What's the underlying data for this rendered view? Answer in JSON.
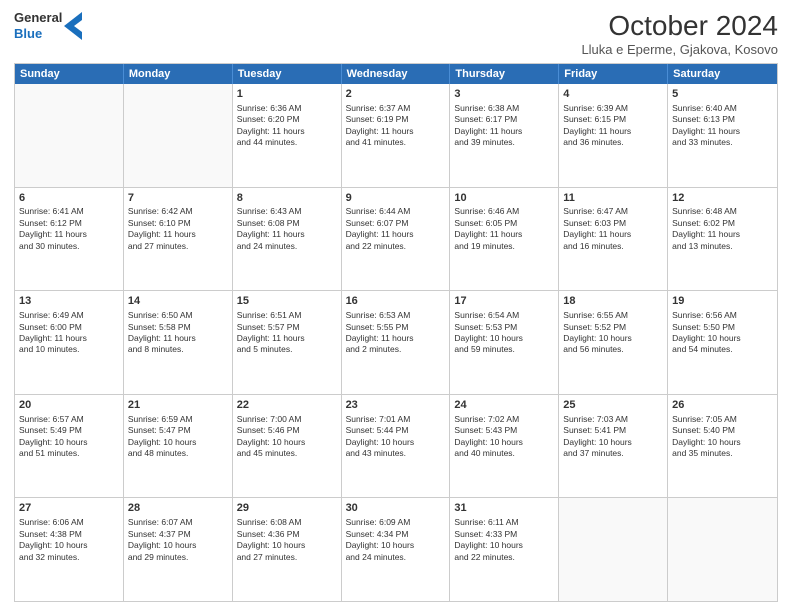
{
  "logo": {
    "line1": "General",
    "line2": "Blue"
  },
  "title": "October 2024",
  "location": "Lluka e Eperme, Gjakova, Kosovo",
  "header": {
    "days": [
      "Sunday",
      "Monday",
      "Tuesday",
      "Wednesday",
      "Thursday",
      "Friday",
      "Saturday"
    ]
  },
  "weeks": [
    [
      {
        "day": "",
        "lines": []
      },
      {
        "day": "",
        "lines": []
      },
      {
        "day": "1",
        "lines": [
          "Sunrise: 6:36 AM",
          "Sunset: 6:20 PM",
          "Daylight: 11 hours",
          "and 44 minutes."
        ]
      },
      {
        "day": "2",
        "lines": [
          "Sunrise: 6:37 AM",
          "Sunset: 6:19 PM",
          "Daylight: 11 hours",
          "and 41 minutes."
        ]
      },
      {
        "day": "3",
        "lines": [
          "Sunrise: 6:38 AM",
          "Sunset: 6:17 PM",
          "Daylight: 11 hours",
          "and 39 minutes."
        ]
      },
      {
        "day": "4",
        "lines": [
          "Sunrise: 6:39 AM",
          "Sunset: 6:15 PM",
          "Daylight: 11 hours",
          "and 36 minutes."
        ]
      },
      {
        "day": "5",
        "lines": [
          "Sunrise: 6:40 AM",
          "Sunset: 6:13 PM",
          "Daylight: 11 hours",
          "and 33 minutes."
        ]
      }
    ],
    [
      {
        "day": "6",
        "lines": [
          "Sunrise: 6:41 AM",
          "Sunset: 6:12 PM",
          "Daylight: 11 hours",
          "and 30 minutes."
        ]
      },
      {
        "day": "7",
        "lines": [
          "Sunrise: 6:42 AM",
          "Sunset: 6:10 PM",
          "Daylight: 11 hours",
          "and 27 minutes."
        ]
      },
      {
        "day": "8",
        "lines": [
          "Sunrise: 6:43 AM",
          "Sunset: 6:08 PM",
          "Daylight: 11 hours",
          "and 24 minutes."
        ]
      },
      {
        "day": "9",
        "lines": [
          "Sunrise: 6:44 AM",
          "Sunset: 6:07 PM",
          "Daylight: 11 hours",
          "and 22 minutes."
        ]
      },
      {
        "day": "10",
        "lines": [
          "Sunrise: 6:46 AM",
          "Sunset: 6:05 PM",
          "Daylight: 11 hours",
          "and 19 minutes."
        ]
      },
      {
        "day": "11",
        "lines": [
          "Sunrise: 6:47 AM",
          "Sunset: 6:03 PM",
          "Daylight: 11 hours",
          "and 16 minutes."
        ]
      },
      {
        "day": "12",
        "lines": [
          "Sunrise: 6:48 AM",
          "Sunset: 6:02 PM",
          "Daylight: 11 hours",
          "and 13 minutes."
        ]
      }
    ],
    [
      {
        "day": "13",
        "lines": [
          "Sunrise: 6:49 AM",
          "Sunset: 6:00 PM",
          "Daylight: 11 hours",
          "and 10 minutes."
        ]
      },
      {
        "day": "14",
        "lines": [
          "Sunrise: 6:50 AM",
          "Sunset: 5:58 PM",
          "Daylight: 11 hours",
          "and 8 minutes."
        ]
      },
      {
        "day": "15",
        "lines": [
          "Sunrise: 6:51 AM",
          "Sunset: 5:57 PM",
          "Daylight: 11 hours",
          "and 5 minutes."
        ]
      },
      {
        "day": "16",
        "lines": [
          "Sunrise: 6:53 AM",
          "Sunset: 5:55 PM",
          "Daylight: 11 hours",
          "and 2 minutes."
        ]
      },
      {
        "day": "17",
        "lines": [
          "Sunrise: 6:54 AM",
          "Sunset: 5:53 PM",
          "Daylight: 10 hours",
          "and 59 minutes."
        ]
      },
      {
        "day": "18",
        "lines": [
          "Sunrise: 6:55 AM",
          "Sunset: 5:52 PM",
          "Daylight: 10 hours",
          "and 56 minutes."
        ]
      },
      {
        "day": "19",
        "lines": [
          "Sunrise: 6:56 AM",
          "Sunset: 5:50 PM",
          "Daylight: 10 hours",
          "and 54 minutes."
        ]
      }
    ],
    [
      {
        "day": "20",
        "lines": [
          "Sunrise: 6:57 AM",
          "Sunset: 5:49 PM",
          "Daylight: 10 hours",
          "and 51 minutes."
        ]
      },
      {
        "day": "21",
        "lines": [
          "Sunrise: 6:59 AM",
          "Sunset: 5:47 PM",
          "Daylight: 10 hours",
          "and 48 minutes."
        ]
      },
      {
        "day": "22",
        "lines": [
          "Sunrise: 7:00 AM",
          "Sunset: 5:46 PM",
          "Daylight: 10 hours",
          "and 45 minutes."
        ]
      },
      {
        "day": "23",
        "lines": [
          "Sunrise: 7:01 AM",
          "Sunset: 5:44 PM",
          "Daylight: 10 hours",
          "and 43 minutes."
        ]
      },
      {
        "day": "24",
        "lines": [
          "Sunrise: 7:02 AM",
          "Sunset: 5:43 PM",
          "Daylight: 10 hours",
          "and 40 minutes."
        ]
      },
      {
        "day": "25",
        "lines": [
          "Sunrise: 7:03 AM",
          "Sunset: 5:41 PM",
          "Daylight: 10 hours",
          "and 37 minutes."
        ]
      },
      {
        "day": "26",
        "lines": [
          "Sunrise: 7:05 AM",
          "Sunset: 5:40 PM",
          "Daylight: 10 hours",
          "and 35 minutes."
        ]
      }
    ],
    [
      {
        "day": "27",
        "lines": [
          "Sunrise: 6:06 AM",
          "Sunset: 4:38 PM",
          "Daylight: 10 hours",
          "and 32 minutes."
        ]
      },
      {
        "day": "28",
        "lines": [
          "Sunrise: 6:07 AM",
          "Sunset: 4:37 PM",
          "Daylight: 10 hours",
          "and 29 minutes."
        ]
      },
      {
        "day": "29",
        "lines": [
          "Sunrise: 6:08 AM",
          "Sunset: 4:36 PM",
          "Daylight: 10 hours",
          "and 27 minutes."
        ]
      },
      {
        "day": "30",
        "lines": [
          "Sunrise: 6:09 AM",
          "Sunset: 4:34 PM",
          "Daylight: 10 hours",
          "and 24 minutes."
        ]
      },
      {
        "day": "31",
        "lines": [
          "Sunrise: 6:11 AM",
          "Sunset: 4:33 PM",
          "Daylight: 10 hours",
          "and 22 minutes."
        ]
      },
      {
        "day": "",
        "lines": []
      },
      {
        "day": "",
        "lines": []
      }
    ]
  ]
}
